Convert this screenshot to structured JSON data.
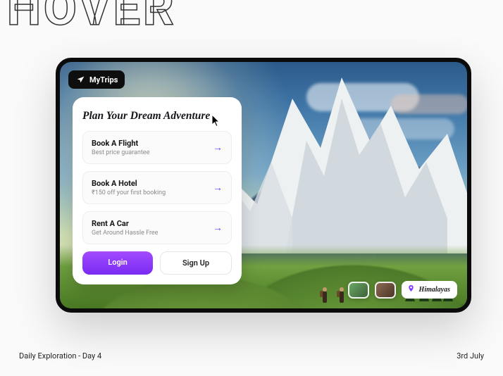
{
  "bgText": "HOVER",
  "brand": {
    "name": "MyTrips"
  },
  "panel": {
    "heading": "Plan Your Dream Adventure",
    "options": [
      {
        "title": "Book A Flight",
        "subtitle": "Best price guarantee"
      },
      {
        "title": "Book A Hotel",
        "subtitle": "₹150 off your first booking"
      },
      {
        "title": "Rent A Car",
        "subtitle": "Get Around Hassle Free"
      }
    ],
    "buttons": {
      "login": "Login",
      "signup": "Sign Up"
    }
  },
  "location": {
    "label": "Himalayas"
  },
  "footer": {
    "left": "Daily Exploration - Day 4",
    "right": "3rd July"
  }
}
